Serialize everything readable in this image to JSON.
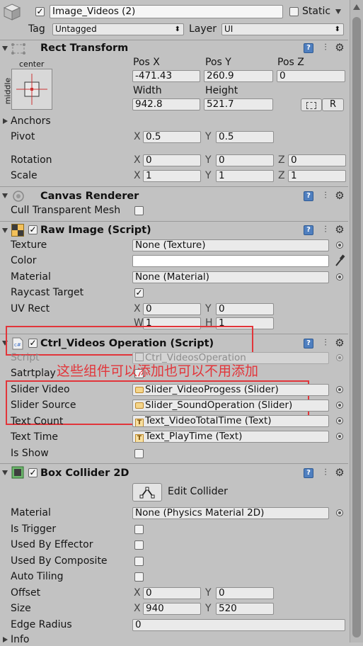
{
  "header": {
    "object_name": "Image_Videos (2)",
    "static_label": "Static",
    "tag_label": "Tag",
    "tag_value": "Untagged",
    "layer_label": "Layer",
    "layer_value": "UI"
  },
  "rect_transform": {
    "title": "Rect Transform",
    "anchor_h": "center",
    "anchor_v": "middle",
    "pos_x_label": "Pos X",
    "pos_y_label": "Pos Y",
    "pos_z_label": "Pos Z",
    "pos_x": "-471.43",
    "pos_y": "260.9",
    "pos_z": "0",
    "width_label": "Width",
    "height_label": "Height",
    "width": "942.8",
    "height": "521.7",
    "r_button": "R",
    "anchors_label": "Anchors",
    "pivot_label": "Pivot",
    "pivot_x": "0.5",
    "pivot_y": "0.5",
    "rotation_label": "Rotation",
    "rot_x": "0",
    "rot_y": "0",
    "rot_z": "0",
    "scale_label": "Scale",
    "scale_x": "1",
    "scale_y": "1",
    "scale_z": "1",
    "x": "X",
    "y": "Y",
    "z": "Z"
  },
  "canvas_renderer": {
    "title": "Canvas Renderer",
    "cull_label": "Cull Transparent Mesh"
  },
  "raw_image": {
    "title": "Raw Image (Script)",
    "texture_label": "Texture",
    "texture_value": "None (Texture)",
    "color_label": "Color",
    "material_label": "Material",
    "material_value": "None (Material)",
    "raycast_label": "Raycast Target",
    "uvrect_label": "UV Rect",
    "uv_x": "0",
    "uv_y": "0",
    "uv_w": "1",
    "uv_h": "1",
    "w": "W",
    "h": "H",
    "x": "X",
    "y": "Y"
  },
  "ctrl": {
    "title": "Ctrl_Videos Operation (Script)",
    "script_label": "Script",
    "script_value": "Ctrl_VideosOperation",
    "satrtplay_label": "Satrtplay",
    "annotation": "这些组件可以添加也可以不用添加",
    "slider_video_label": "Slider Video",
    "slider_video_value": "Slider_VideoProgess (Slider)",
    "slider_source_label": "Slider Source",
    "slider_source_value": "Slider_SoundOperation (Slider)",
    "text_count_label": "Text Count",
    "text_count_value": "Text_VideoTotalTime (Text)",
    "text_time_label": "Text Time",
    "text_time_value": "Text_PlayTime (Text)",
    "is_show_label": "Is Show"
  },
  "box_collider": {
    "title": "Box Collider 2D",
    "edit_collider": "Edit Collider",
    "material_label": "Material",
    "material_value": "None (Physics Material 2D)",
    "is_trigger_label": "Is Trigger",
    "used_by_effector_label": "Used By Effector",
    "used_by_composite_label": "Used By Composite",
    "auto_tiling_label": "Auto Tiling",
    "offset_label": "Offset",
    "offset_x": "0",
    "offset_y": "0",
    "size_label": "Size",
    "size_x": "940",
    "size_y": "520",
    "edge_radius_label": "Edge Radius",
    "edge_radius": "0",
    "info_label": "Info",
    "x": "X",
    "y": "Y"
  },
  "colors": {
    "highlight_red": "#e2353a",
    "panel_bg": "#c2c2c2"
  },
  "icons": [
    "gameobject-cube-icon",
    "dropdown-arrow-icon",
    "gear-icon",
    "help-book-icon",
    "preset-icon",
    "eyedropper-icon",
    "object-picker-icon",
    "edit-collider-icon"
  ]
}
